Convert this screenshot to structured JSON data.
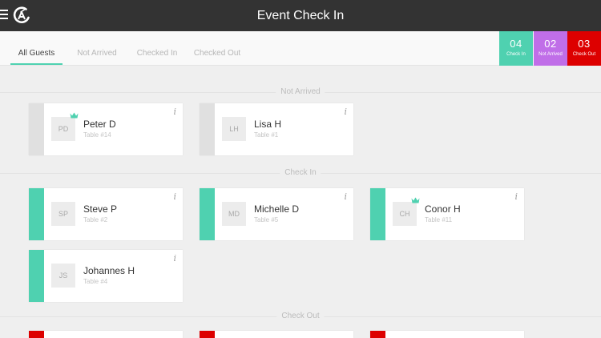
{
  "header": {
    "title": "Event Check In",
    "menu_icon": "hamburger-icon",
    "logo_icon": "app-logo-icon"
  },
  "tabs": [
    {
      "label": "All Guests",
      "active": true
    },
    {
      "label": "Not Arrived",
      "active": false
    },
    {
      "label": "Checked In",
      "active": false
    },
    {
      "label": "Checked Out",
      "active": false
    }
  ],
  "stats": [
    {
      "count": "04",
      "label": "Check In",
      "color": "#4fd1b0"
    },
    {
      "count": "02",
      "label": "Not Arrived",
      "color": "#c06ee8"
    },
    {
      "count": "03",
      "label": "Check Out",
      "color": "#dd0000"
    }
  ],
  "sections": {
    "not_arrived": {
      "title": "Not Arrived",
      "guests": [
        {
          "initials": "PD",
          "name": "Peter D",
          "table": "Table #14",
          "vip": true
        },
        {
          "initials": "LH",
          "name": "Lisa H",
          "table": "Table #1",
          "vip": false
        }
      ]
    },
    "checked_in": {
      "title": "Check In",
      "guests": [
        {
          "initials": "SP",
          "name": "Steve P",
          "table": "Table #2",
          "vip": false
        },
        {
          "initials": "MD",
          "name": "Michelle D",
          "table": "Table #5",
          "vip": false
        },
        {
          "initials": "CH",
          "name": "Conor H",
          "table": "Table #11",
          "vip": true
        },
        {
          "initials": "JS",
          "name": "Johannes H",
          "table": "Table #4",
          "vip": false
        }
      ]
    },
    "checked_out": {
      "title": "Check Out"
    }
  },
  "info_glyph": "i",
  "colors": {
    "not_arrived_bar": "#e0e0e0",
    "checked_in_bar": "#4fd1b0",
    "checked_out_bar": "#dd0000",
    "crown": "#4fd1b0"
  }
}
